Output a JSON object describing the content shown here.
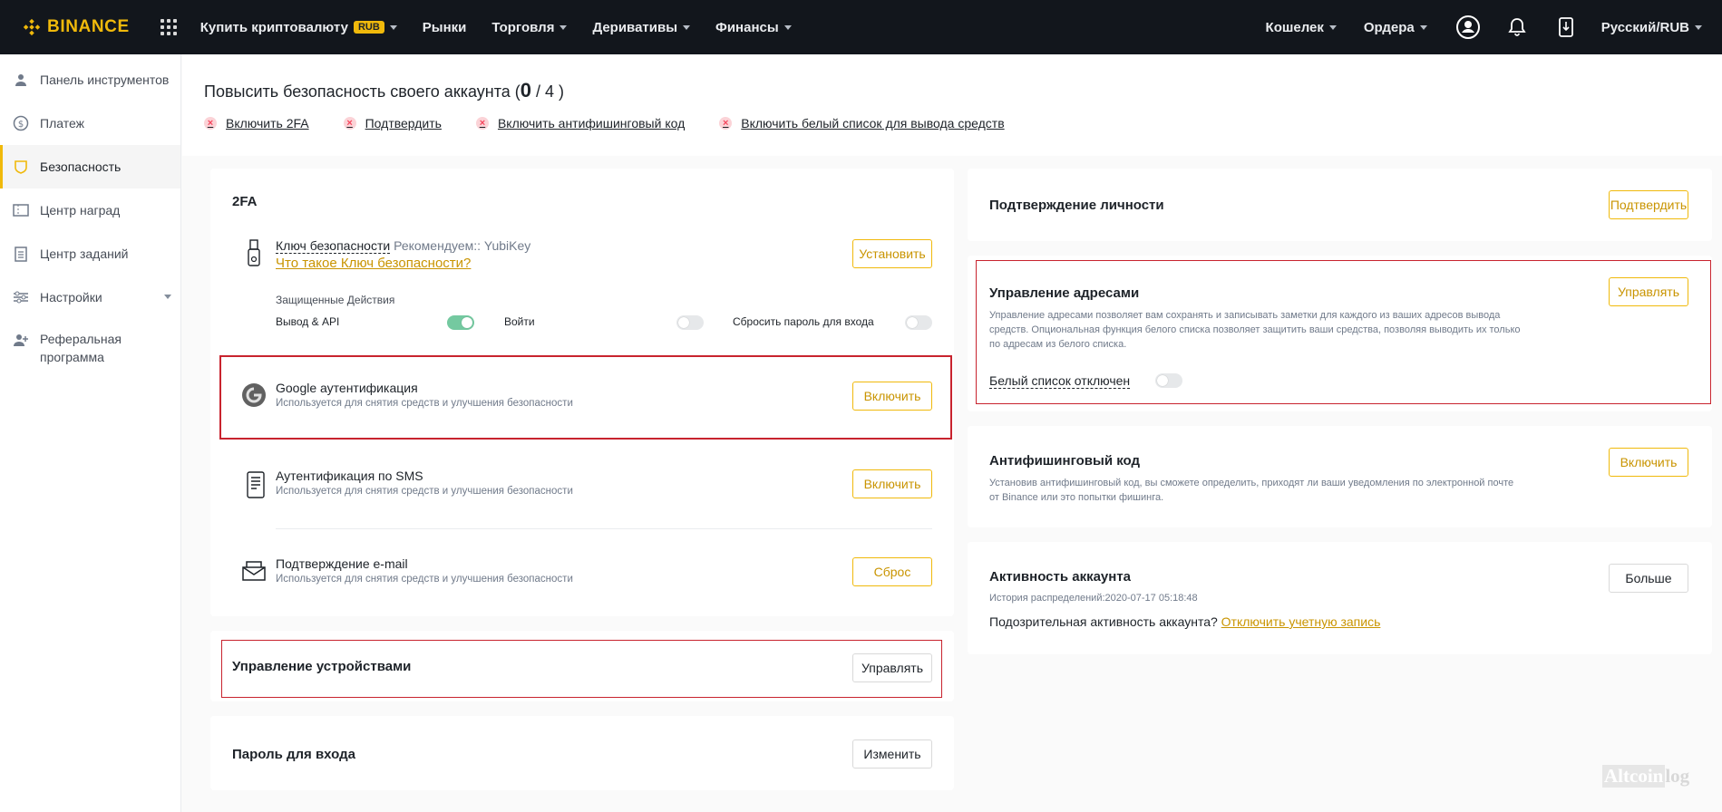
{
  "app": {
    "brand": "BINANCE",
    "brand_color": "#F0B90B"
  },
  "topnav": {
    "buy_crypto": "Купить криптовалюту",
    "buy_badge": "RUB",
    "markets": "Рынки",
    "trade": "Торговля",
    "derivatives": "Деривативы",
    "finance": "Финансы",
    "wallet": "Кошелек",
    "orders": "Ордера",
    "language": "Русский/RUB"
  },
  "sidebar": {
    "items": [
      {
        "label": "Панель инструментов",
        "icon": "user-icon"
      },
      {
        "label": "Платеж",
        "icon": "dollar-icon"
      },
      {
        "label": "Безопасность",
        "icon": "shield-icon",
        "active": true
      },
      {
        "label": "Центр наград",
        "icon": "ticket-icon"
      },
      {
        "label": "Центр заданий",
        "icon": "checklist-icon"
      },
      {
        "label": "Настройки",
        "icon": "settings-icon"
      },
      {
        "label": "Реферальная программа",
        "icon": "add-user-icon"
      }
    ]
  },
  "security": {
    "title": "Повысить безопасность своего аккаунта (",
    "progress_done": "0",
    "progress_sep": " / ",
    "progress_total": "4",
    "title_close": " )",
    "todos": [
      "Включить 2FA",
      "Подтвердить",
      "Включить антифишинговый код",
      "Включить белый список для вывода средств"
    ]
  },
  "twofa": {
    "title": "2FA",
    "security_key": {
      "title": "Ключ безопасности",
      "recommend": "Рекомендуем:: YubiKey",
      "link": "Что такое Ключ безопасности?",
      "button": "Установить"
    },
    "protected_actions": {
      "label": "Защищенные Действия",
      "withdraw_api": "Вывод & API",
      "withdraw_api_on": true,
      "login": "Войти",
      "login_on": false,
      "reset_password": "Сбросить пароль для входа",
      "reset_password_on": false
    },
    "google": {
      "title": "Google аутентификация",
      "sub": "Используется для снятия средств и улучшения безопасности",
      "button": "Включить"
    },
    "sms": {
      "title": "Аутентификация по SMS",
      "sub": "Используется для снятия средств и улучшения безопасности",
      "button": "Включить"
    },
    "email": {
      "title": "Подтверждение e-mail",
      "sub": "Используется для снятия средств и улучшения безопасности",
      "button": "Сброс"
    }
  },
  "devices": {
    "title": "Управление устройствами",
    "button": "Управлять"
  },
  "password": {
    "title": "Пароль для входа",
    "button": "Изменить"
  },
  "identity": {
    "title": "Подтверждение личности",
    "button": "Подтвердить"
  },
  "address": {
    "title": "Управление адресами",
    "desc_line1": "Управление адресами позволяет вам сохранять и записывать заметки для каждого из ваших адресов вывода",
    "desc_line2": "средств. Опциональная функция белого списка позволяет защитить ваши средства, позволяя выводить их только",
    "desc_line3": "по адресам из белого списка.",
    "whitelist": "Белый список отключен",
    "whitelist_on": false,
    "button": "Управлять"
  },
  "antiphishing": {
    "title": "Антифишинговый код",
    "desc_line1": "Установив антифишинговый код, вы сможете определить, приходят ли ваши уведомления по электронной почте",
    "desc_line2": "от Binance или это попытки фишинга.",
    "button": "Включить"
  },
  "activity": {
    "title": "Активность аккаунта",
    "history": "История распределений:2020-07-17 05:18:48",
    "suspicious": "Подозрительная активность аккаунта?",
    "disable_link": "Отключить учетную запись",
    "button": "Больше"
  },
  "watermark": {
    "part1": "Altcoin",
    "part2": "log"
  }
}
